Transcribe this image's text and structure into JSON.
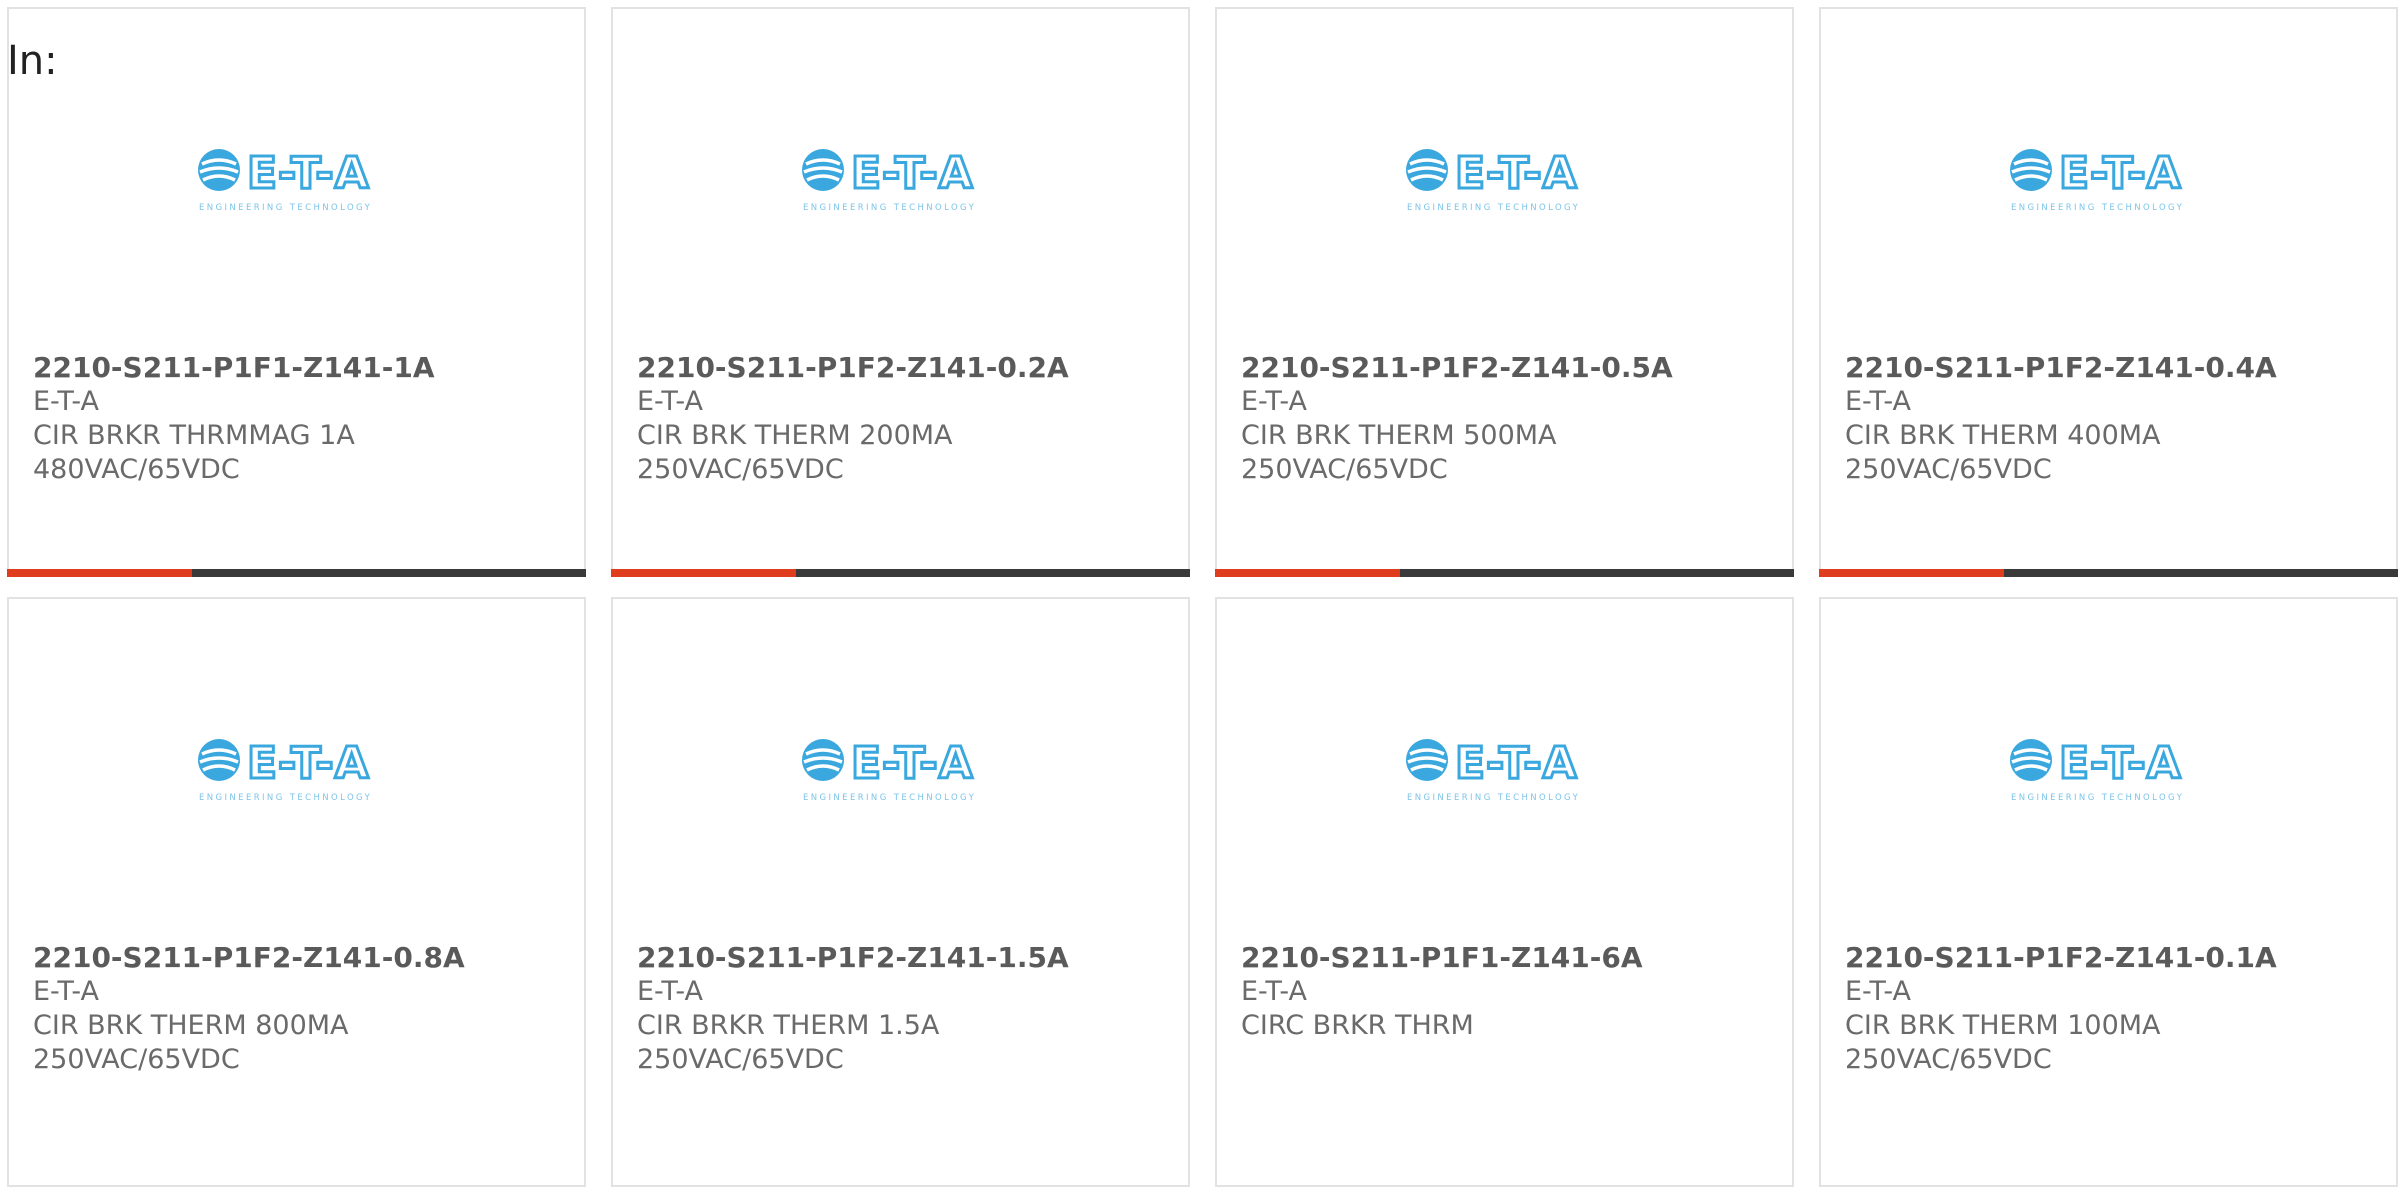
{
  "prefix_label": "In:",
  "colors": {
    "accent_bar": "#e03c1e",
    "bar_track": "#3a3a3a",
    "logo_blue": "#3aa8de"
  },
  "logo": {
    "main": "E-T-A",
    "tagline": "ENGINEERING TECHNOLOGY",
    "icon": "eta-globe-icon"
  },
  "products": [
    {
      "part_number": "2210-S211-P1F1-Z141-1A",
      "manufacturer": "E-T-A",
      "desc_line1": "CIR BRKR THRMMAG 1A",
      "desc_line2": "480VAC/65VDC",
      "progress": 0.32
    },
    {
      "part_number": "2210-S211-P1F2-Z141-0.2A",
      "manufacturer": "E-T-A",
      "desc_line1": "CIR BRK THERM 200MA",
      "desc_line2": "250VAC/65VDC",
      "progress": 0.32
    },
    {
      "part_number": "2210-S211-P1F2-Z141-0.5A",
      "manufacturer": "E-T-A",
      "desc_line1": "CIR BRK THERM 500MA",
      "desc_line2": "250VAC/65VDC",
      "progress": 0.32
    },
    {
      "part_number": "2210-S211-P1F2-Z141-0.4A",
      "manufacturer": "E-T-A",
      "desc_line1": "CIR BRK THERM 400MA",
      "desc_line2": "250VAC/65VDC",
      "progress": 0.32
    },
    {
      "part_number": "2210-S211-P1F2-Z141-0.8A",
      "manufacturer": "E-T-A",
      "desc_line1": "CIR BRK THERM 800MA",
      "desc_line2": "250VAC/65VDC"
    },
    {
      "part_number": "2210-S211-P1F2-Z141-1.5A",
      "manufacturer": "E-T-A",
      "desc_line1": "CIR BRKR THERM 1.5A",
      "desc_line2": "250VAC/65VDC"
    },
    {
      "part_number": "2210-S211-P1F1-Z141-6A",
      "manufacturer": "E-T-A",
      "desc_line1": "CIRC BRKR THRM",
      "desc_line2": ""
    },
    {
      "part_number": "2210-S211-P1F2-Z141-0.1A",
      "manufacturer": "E-T-A",
      "desc_line1": "CIR BRK THERM 100MA",
      "desc_line2": "250VAC/65VDC"
    }
  ]
}
